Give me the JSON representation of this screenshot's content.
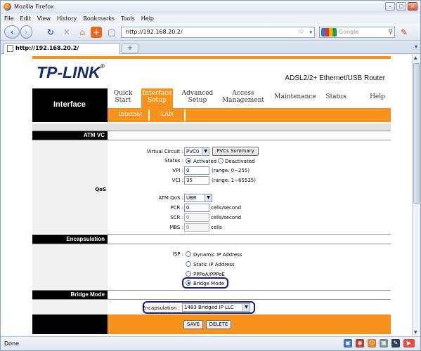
{
  "browser": {
    "title": "Mozilla Firefox",
    "menu": [
      "File",
      "Edit",
      "View",
      "History",
      "Bookmarks",
      "Tools",
      "Help"
    ],
    "url": "http://192.168.20.2/",
    "search_placeholder": "Google",
    "tab_title": "http://192.168.20.2/",
    "new_tab": "+",
    "status": "Done"
  },
  "router": {
    "brand": "TP-LINK",
    "brand_reg": "®",
    "model": "ADSL2/2+ Ethernet/USB Router",
    "section": "Interface",
    "nav": [
      {
        "l1": "Quick",
        "l2": "Start"
      },
      {
        "l1": "Interface",
        "l2": "Setup"
      },
      {
        "l1": "Advanced",
        "l2": "Setup"
      },
      {
        "l1": "Access",
        "l2": "Management"
      },
      {
        "l1": "Maintenance",
        "l2": ""
      },
      {
        "l1": "Status",
        "l2": ""
      },
      {
        "l1": "Help",
        "l2": ""
      }
    ],
    "subnav": [
      "Internet",
      "LAN"
    ]
  },
  "form": {
    "sections": {
      "atm": "ATM VC",
      "qos": "QoS",
      "encap": "Encapsulation",
      "bridge": "Bridge Mode"
    },
    "virtual_circuit": {
      "label": "Virtual Circuit :",
      "value": "PVC0",
      "summary_button": "PVCs Summary"
    },
    "status": {
      "label": "Status :",
      "activated": "Activated",
      "deactivated": "Deactivated",
      "selected": "Activated"
    },
    "vpi": {
      "label": "VPI :",
      "value": "0",
      "range": "(range: 0~255)"
    },
    "vci": {
      "label": "VCI :",
      "value": "35",
      "range": "(range: 1~65535)"
    },
    "atm_qos": {
      "label": "ATM QoS :",
      "value": "UBR"
    },
    "pcr": {
      "label": "PCR :",
      "value": "0",
      "unit": "cells/second"
    },
    "scr": {
      "label": "SCR :",
      "value": "0",
      "unit": "cells/second"
    },
    "mbs": {
      "label": "MBS :",
      "value": "0",
      "unit": "cells"
    },
    "isp": {
      "label": "ISP :",
      "options": [
        "Dynamic IP Address",
        "Static IP Address",
        "PPPoA/PPPoE",
        "Bridge Mode"
      ],
      "selected": "Bridge Mode"
    },
    "encapsulation": {
      "label": "Encapsulation :",
      "value": "1483 Bridged IP LLC"
    },
    "buttons": {
      "save": "SAVE",
      "delete": "DELETE"
    }
  },
  "colors": {
    "accent": "#f7921e",
    "highlight": "#1414a8",
    "brand": "#1a2d6b"
  }
}
